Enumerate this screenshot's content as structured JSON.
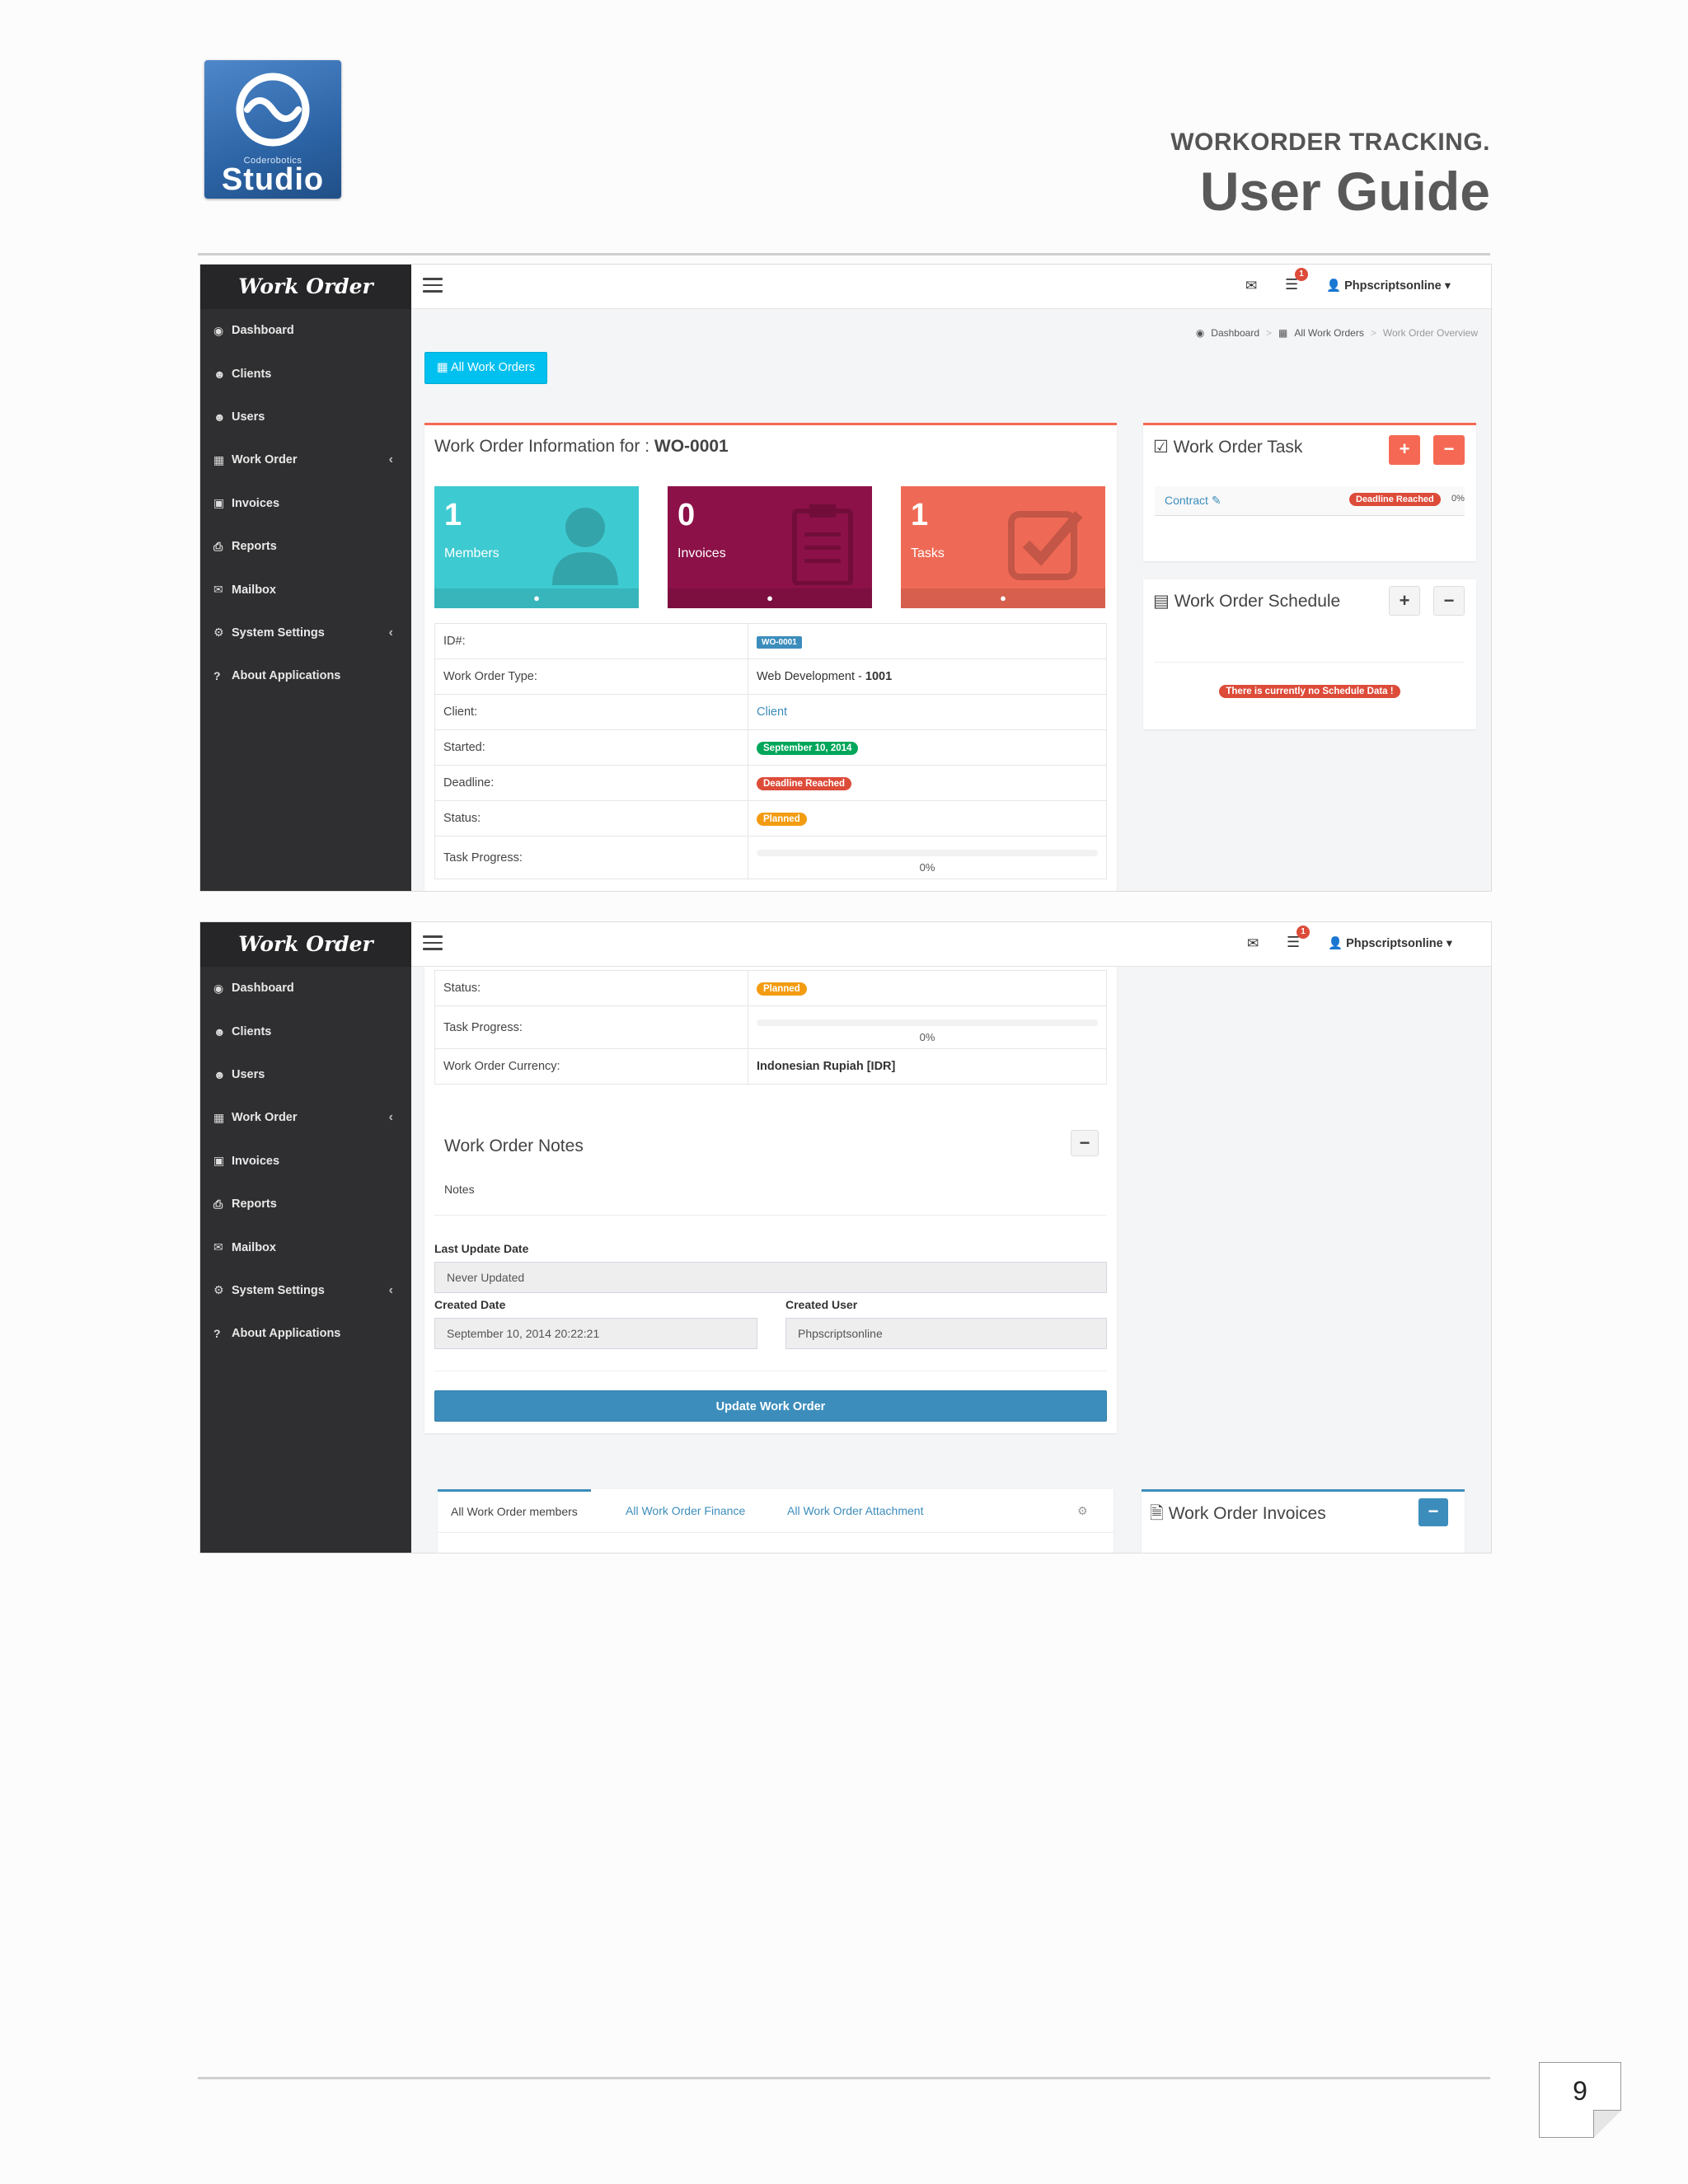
{
  "document": {
    "logo": {
      "small_text": "Coderobotics",
      "big_text": "Studio"
    },
    "subtitle": "WORKORDER TRACKING.",
    "title": "User Guide",
    "page_number": "9"
  },
  "app": {
    "brand": "Work Order",
    "sidebar": [
      {
        "label": "Dashboard",
        "icon": "dashboard-icon"
      },
      {
        "label": "Clients",
        "icon": "users-icon"
      },
      {
        "label": "Users",
        "icon": "users-icon"
      },
      {
        "label": "Work Order",
        "icon": "chart-icon",
        "expandable": true
      },
      {
        "label": "Invoices",
        "icon": "money-icon"
      },
      {
        "label": "Reports",
        "icon": "print-icon"
      },
      {
        "label": "Mailbox",
        "icon": "envelope-icon"
      },
      {
        "label": "System Settings",
        "icon": "cogs-icon",
        "expandable": true
      },
      {
        "label": "About Applications",
        "icon": "question-icon"
      }
    ],
    "topbar": {
      "notification_count": "1",
      "user": "Phpscriptsonline"
    }
  },
  "screen1": {
    "breadcrumb": [
      "Dashboard",
      "All Work Orders",
      "Work Order Overview"
    ],
    "all_orders_button": "All Work Orders",
    "info_title_prefix": "Work Order Information for :",
    "info_title_id": "WO-0001",
    "tiles": [
      {
        "number": "1",
        "label": "Members",
        "color": "#3ecad1"
      },
      {
        "number": "0",
        "label": "Invoices",
        "color": "#8c1148"
      },
      {
        "number": "1",
        "label": "Tasks",
        "color": "#ef6a56"
      }
    ],
    "rows": [
      {
        "label": "ID#:",
        "value": "WO-0001"
      },
      {
        "label": "Work Order Type:",
        "value": "Web Development - ",
        "value_bold": "1001"
      },
      {
        "label": "Client:",
        "value": "Client"
      },
      {
        "label": "Started:",
        "value": "September 10, 2014"
      },
      {
        "label": "Deadline:",
        "value": "Deadline Reached"
      },
      {
        "label": "Status:",
        "value": "Planned"
      },
      {
        "label": "Task Progress:",
        "value": "0%"
      }
    ],
    "task_box": {
      "title": "Work Order Task",
      "task_name": "Contract",
      "task_status": "Deadline Reached",
      "task_percent": "0%"
    },
    "schedule_box": {
      "title": "Work Order Schedule",
      "empty_message": "There is currently no Schedule Data !"
    }
  },
  "screen2": {
    "rows": [
      {
        "label": "Status:",
        "value": "Planned"
      },
      {
        "label": "Task Progress:",
        "value": "0%"
      },
      {
        "label": "Work Order Currency:",
        "value": "Indonesian Rupiah [IDR]"
      }
    ],
    "notes": {
      "title": "Work Order Notes",
      "body": "Notes"
    },
    "last_update_label": "Last Update Date",
    "last_update_value": "Never Updated",
    "created_date_label": "Created Date",
    "created_date_value": "September 10, 2014 20:22:21",
    "created_user_label": "Created User",
    "created_user_value": "Phpscriptsonline",
    "update_button": "Update Work Order",
    "tabs": [
      "All Work Order members",
      "All Work Order Finance",
      "All Work Order Attachment"
    ],
    "invoices_title": "Work Order Invoices"
  }
}
